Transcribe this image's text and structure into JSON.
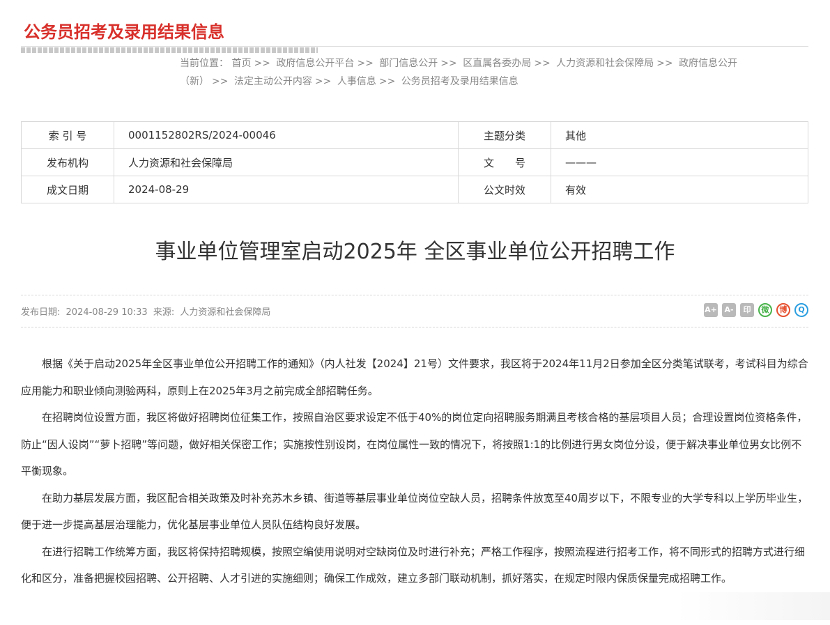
{
  "header": {
    "section_title": "公务员招考及录用结果信息"
  },
  "breadcrumb": {
    "prefix": "当前位置：",
    "items": [
      "首页",
      "政府信息公开平台",
      "部门信息公开",
      "区直属各委办局",
      "人力资源和社会保障局",
      "政府信息公开（新）",
      "法定主动公开内容",
      "人事信息",
      "公务员招考及录用结果信息"
    ],
    "separator": ">>"
  },
  "meta_table": {
    "rows": [
      {
        "label1": "索 引 号",
        "value1": "0001152802RS/2024-00046",
        "label2": "主题分类",
        "value2": "其他"
      },
      {
        "label1": "发布机构",
        "value1": "人力资源和社会保障局",
        "label2": "文　　号",
        "value2": "———"
      },
      {
        "label1": "成文日期",
        "value1": "2024-08-29",
        "label2": "公文时效",
        "value2": "有效"
      }
    ]
  },
  "article": {
    "title": "事业单位管理室启动2025年 全区事业单位公开招聘工作",
    "pub_date_label": "发布日期:",
    "pub_date": "2024-08-29 10:33",
    "source_label": "来源:",
    "source": "人力资源和社会保障局",
    "paragraphs": [
      "根据《关于启动2025年全区事业单位公开招聘工作的通知》（内人社发【2024】21号）文件要求，我区将于2024年11月2日参加全区分类笔试联考，考试科目为综合应用能力和职业倾向测验两科，原则上在2025年3月之前完成全部招聘任务。",
      "在招聘岗位设置方面，我区将做好招聘岗位征集工作，按照自治区要求设定不低于40%的岗位定向招聘服务期满且考核合格的基层项目人员；合理设置岗位资格条件，防止“因人设岗”“萝卜招聘”等问题，做好相关保密工作；实施按性别设岗，在岗位属性一致的情况下，将按照1:1的比例进行男女岗位分设，便于解决事业单位男女比例不平衡现象。",
      "在助力基层发展方面，我区配合相关政策及时补充苏木乡镇、街道等基层事业单位岗位空缺人员，招聘条件放宽至40周岁以下，不限专业的大学专科以上学历毕业生，便于进一步提高基层治理能力，优化基层事业单位人员队伍结构良好发展。",
      "在进行招聘工作统筹方面，我区将保持招聘规模，按照空编使用说明对空缺岗位及时进行补充；严格工作程序，按照流程进行招考工作，将不同形式的招聘方式进行细化和区分，准备把握校园招聘、公开招聘、人才引进的实施细则；确保工作成效，建立多部门联动机制，抓好落实，在规定时限内保质保量完成招聘工作。"
    ]
  },
  "tools": {
    "font_larger": "A+",
    "font_smaller": "A-",
    "print": "印",
    "wechat": "微",
    "weibo": "博",
    "qq": "Q",
    "icons": [
      "font-larger-icon",
      "font-smaller-icon",
      "print-icon",
      "wechat-icon",
      "weibo-icon",
      "qq-icon"
    ]
  },
  "colors": {
    "accent": "#d8302b",
    "wechat": "#48b34a",
    "weibo": "#e6502f",
    "qq": "#2b9ee0"
  }
}
